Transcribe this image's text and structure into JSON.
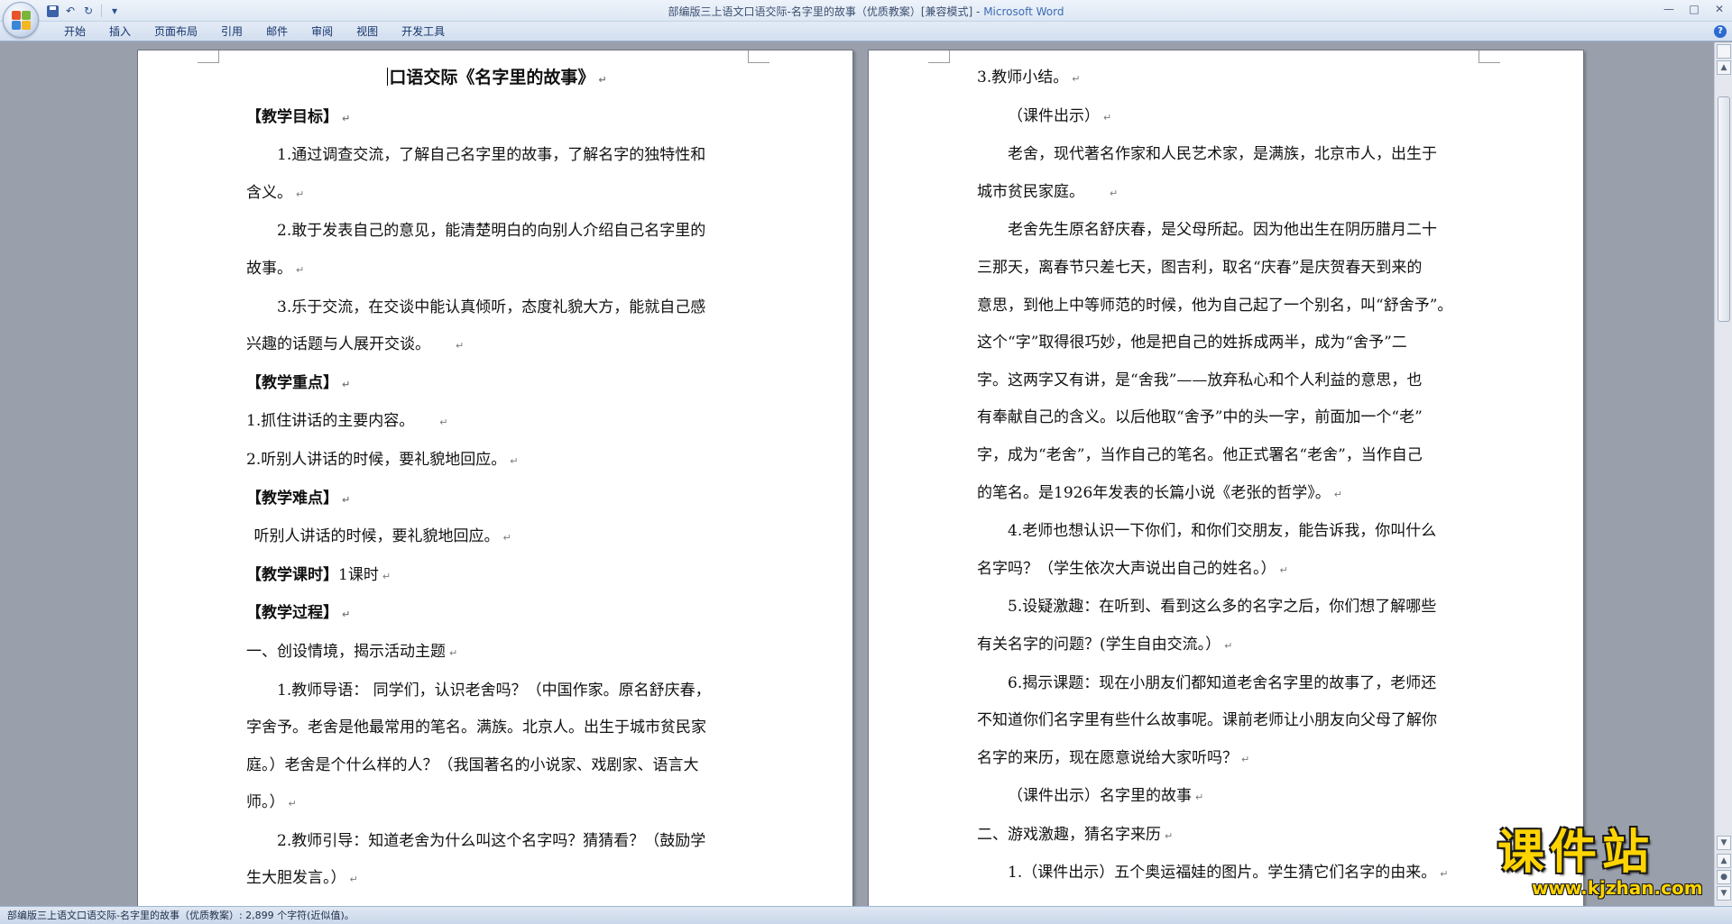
{
  "window": {
    "title": "部编版三上语文口语交际-名字里的故事（优质教案）[兼容模式] -",
    "app_name": "Microsoft Word",
    "controls": [
      "—",
      "□",
      "✕"
    ]
  },
  "qat": {
    "undo": "↶",
    "redo": "↻",
    "dropdown": "▾"
  },
  "ribbon": {
    "tabs": [
      "开始",
      "插入",
      "页面布局",
      "引用",
      "邮件",
      "审阅",
      "视图",
      "开发工具"
    ],
    "help": "?"
  },
  "left_page": {
    "lines": [
      "口语交际《名字里的故事》",
      "【教学目标】",
      "1.通过调查交流，了解自己名字里的故事，了解名字的独特性和",
      "含义。",
      "2.敢于发表自己的意见，能清楚明白的向别人介绍自己名字里的",
      "故事。",
      "3.乐于交流，在交谈中能认真倾听，态度礼貌大方，能就自己感",
      "兴趣的话题与人展开交谈。",
      "【教学重点】",
      "1.抓住讲话的主要内容。",
      "2.听别人讲话的时候，要礼貌地回应。",
      "【教学难点】",
      "听别人讲话的时候，要礼貌地回应。",
      "【教学课时】",
      "1课时",
      "【教学过程】",
      "一、创设情境，揭示活动主题",
      "1.教师导语：  同学们，认识老舍吗？（中国作家。原名舒庆春，",
      "字舍予。老舍是他最常用的笔名。满族。北京人。出生于城市贫民家",
      "庭。）老舍是个什么样的人？（我国著名的小说家、戏剧家、语言大",
      "师。）",
      "2.教师引导：知道老舍为什么叫这个名字吗？猜猜看？（鼓励学",
      "生大胆发言。）"
    ]
  },
  "right_page": {
    "lines": [
      "3.教师小结。",
      "（课件出示）",
      "老舍，现代著名作家和人民艺术家，是满族，北京市人，出生于",
      "城市贫民家庭。",
      "老舍先生原名舒庆春，是父母所起。因为他出生在阴历腊月二十",
      "三那天，离春节只差七天，图吉利，取名“庆春”是庆贺春天到来的",
      "意思，到他上中等师范的时候，他为自己起了一个别名，叫“舒舍予”。",
      "这个“字”取得很巧妙，他是把自己的姓拆成两半，成为“舍予”二",
      "字。这两字又有讲，是“舍我”——放弃私心和个人利益的意思，也",
      "有奉献自己的含义。以后他取“舍予”中的头一字，前面加一个“老”",
      "字，成为“老舍”，当作自己的笔名。他正式署名“老舍”，当作自己",
      "的笔名。是1926年发表的长篇小说《老张的哲学》。",
      "4.老师也想认识一下你们，和你们交朋友，能告诉我，你叫什么",
      "名字吗？（学生依次大声说出自己的姓名。）",
      "5.设疑激趣：在听到、看到这么多的名字之后，你们想了解哪些",
      "有关名字的问题？(学生自由交流。）",
      "6.揭示课题：现在小朋友们都知道老舍名字里的故事了，老师还",
      "不知道你们名字里有些什么故事呢。课前老师让小朋友向父母了解你",
      "名字的来历，现在愿意说给大家听吗？",
      "（课件出示）名字里的故事",
      "二、游戏激趣，猜名字来历",
      "1.（课件出示）五个奥运福娃的图片。学生猜它们名字的由来。"
    ]
  },
  "status_bar": {
    "text": "部编版三上语文口语交际-名字里的故事（优质教案）: 2,899 个字符(近似值)。"
  },
  "watermark": {
    "chinese": "课件站",
    "url": "www.kjzhan.com"
  },
  "colors": {
    "title_app": "#3d6cb5",
    "watermark": "#ffd400",
    "ribbon_text": "#15346b"
  },
  "marks": {
    "paragraph": "↵"
  }
}
